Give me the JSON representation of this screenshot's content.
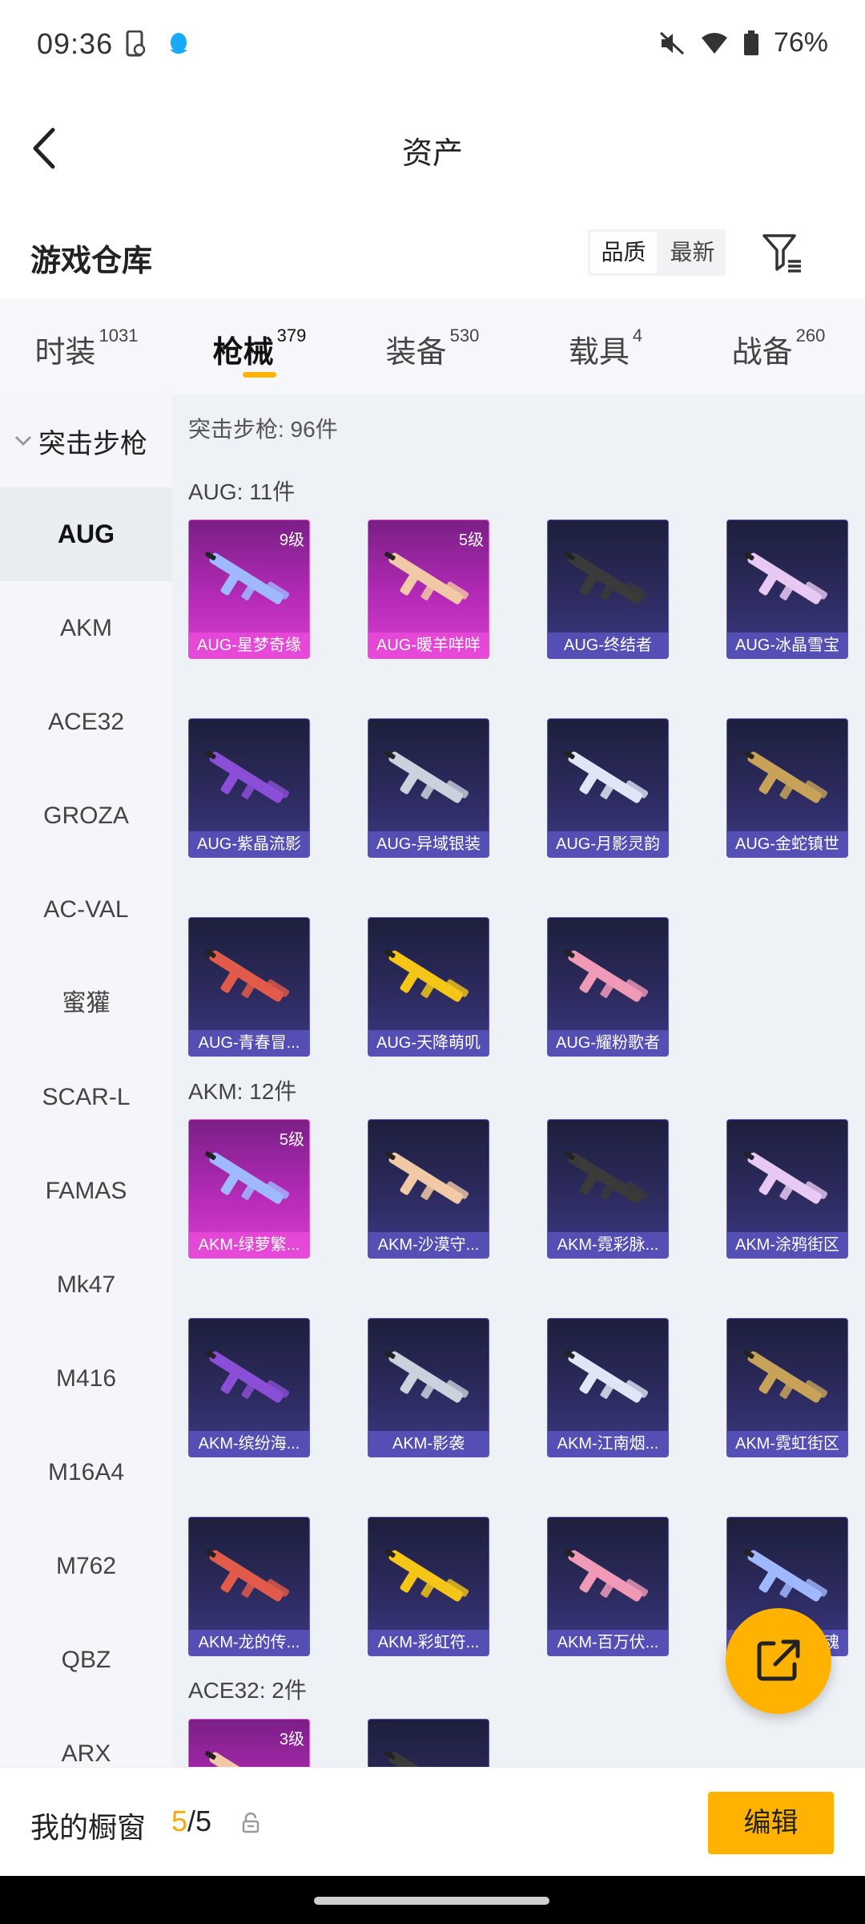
{
  "status": {
    "time": "09:36",
    "battery": "76%"
  },
  "title": "资产",
  "section_title": "游戏仓库",
  "sort": {
    "quality": "品质",
    "newest": "最新"
  },
  "tabs": [
    {
      "label": "时装",
      "count": "1031"
    },
    {
      "label": "枪械",
      "count": "379"
    },
    {
      "label": "装备",
      "count": "530"
    },
    {
      "label": "载具",
      "count": "4"
    },
    {
      "label": "战备",
      "count": "260"
    }
  ],
  "sidebar": {
    "group": "突击步枪",
    "items": [
      "AUG",
      "AKM",
      "ACE32",
      "GROZA",
      "AC-VAL",
      "蜜獾",
      "SCAR-L",
      "FAMAS",
      "Mk47",
      "M416",
      "M16A4",
      "M762",
      "QBZ",
      "ARX"
    ]
  },
  "content": {
    "total": "突击步枪: 96件",
    "groups": [
      {
        "header": "AUG: 11件",
        "items": [
          {
            "name": "AUG-星梦奇缘",
            "level": "9级"
          },
          {
            "name": "AUG-暖羊咩咩",
            "level": "5级"
          },
          {
            "name": "AUG-终结者"
          },
          {
            "name": "AUG-冰晶雪宝"
          },
          {
            "name": "AUG-紫晶流影"
          },
          {
            "name": "AUG-异域银装"
          },
          {
            "name": "AUG-月影灵韵"
          },
          {
            "name": "AUG-金蛇镇世"
          },
          {
            "name": "AUG-青春冒..."
          },
          {
            "name": "AUG-天降萌叽"
          },
          {
            "name": "AUG-耀粉歌者"
          }
        ]
      },
      {
        "header": "AKM: 12件",
        "items": [
          {
            "name": "AKM-绿萝繁...",
            "level": "5级"
          },
          {
            "name": "AKM-沙漠守..."
          },
          {
            "name": "AKM-霓彩脉..."
          },
          {
            "name": "AKM-涂鸦街区"
          },
          {
            "name": "AKM-缤纷海..."
          },
          {
            "name": "AKM-影袭"
          },
          {
            "name": "AKM-江南烟..."
          },
          {
            "name": "AKM-霓虹街区"
          },
          {
            "name": "AKM-龙的传..."
          },
          {
            "name": "AKM-彩虹符..."
          },
          {
            "name": "AKM-百万伏..."
          },
          {
            "name": "魂"
          }
        ]
      },
      {
        "header": "ACE32: 2件",
        "items": [
          {
            "name": "",
            "level": "3级"
          },
          {
            "name": ""
          }
        ]
      }
    ]
  },
  "bottom": {
    "label": "我的橱窗",
    "current": "5",
    "sep": "/",
    "total": "5",
    "edit": "编辑"
  },
  "colors": {
    "accent": "#ffb300",
    "card_purple": "#c233c0",
    "card_blue": "#2e2c62"
  },
  "icons": [
    "back-icon",
    "filter-icon",
    "share-icon",
    "lock-icon",
    "chevron-down-icon",
    "wifi-icon",
    "battery-icon",
    "mute-icon"
  ]
}
